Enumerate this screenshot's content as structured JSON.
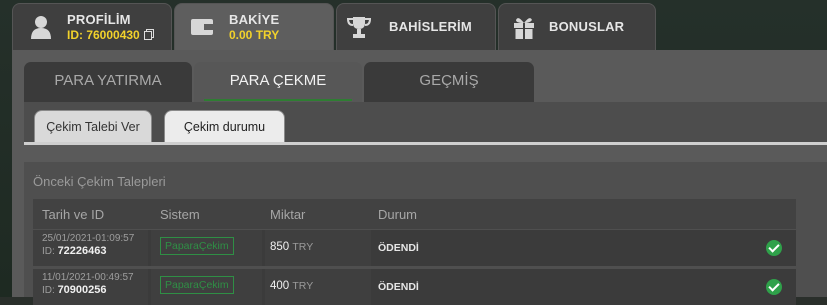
{
  "top_tabs": [
    {
      "label": "PROFİLİM",
      "sub": "ID: 76000430",
      "icon": "user-icon"
    },
    {
      "label": "BAKİYE",
      "sub": "0.00 TRY",
      "icon": "wallet-icon"
    },
    {
      "label": "BAHİSLERİM",
      "icon": "trophy-icon"
    },
    {
      "label": "BONUSLAR",
      "icon": "gift-icon"
    }
  ],
  "section_tabs": [
    "PARA YATIRMA",
    "PARA ÇEKME",
    "GEÇMİŞ"
  ],
  "sub_tabs": [
    "Çekim Talebi Ver",
    "Çekim durumu"
  ],
  "history": {
    "title": "Önceki Çekim Talepleri",
    "headers": [
      "Tarih ve ID",
      "Sistem",
      "Miktar",
      "Durum"
    ],
    "rows": [
      {
        "date": "25/01/2021-01:09:57",
        "id_label": "ID:",
        "id": "72226463",
        "system": "PaparaÇekim",
        "amount": "850",
        "currency": "TRY",
        "status": "ÖDENDİ"
      },
      {
        "date": "11/01/2021-00:49:57",
        "id_label": "ID:",
        "id": "70900256",
        "system": "PaparaÇekim",
        "amount": "400",
        "currency": "TRY",
        "status": "ÖDENDİ"
      }
    ]
  },
  "colors": {
    "accent_green": "#2e7d32",
    "balance_yellow": "#f2d22b"
  }
}
